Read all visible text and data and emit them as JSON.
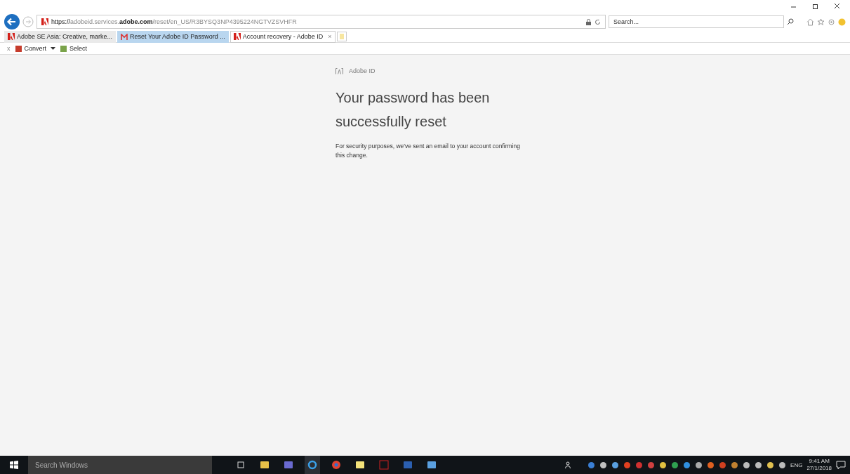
{
  "browser": {
    "address": {
      "scheme": "https://",
      "host_prefix": "adobeid.services.",
      "host_domain": "adobe.com",
      "path": "/reset/en_US/R3BYSQ3NP4395224NGTVZSVHFR"
    },
    "search": {
      "placeholder": "Search..."
    },
    "tabs": [
      {
        "label": "Adobe SE Asia: Creative, marke...",
        "selected": false,
        "hovered": false
      },
      {
        "label": "Reset Your Adobe ID Password ...",
        "selected": false,
        "hovered": true
      },
      {
        "label": "Account recovery - Adobe ID",
        "selected": true,
        "hovered": false
      }
    ],
    "close_tab": "×",
    "command_close": "x",
    "commands": [
      {
        "label": "Convert",
        "dropdown": true
      },
      {
        "label": "Select",
        "dropdown": false
      }
    ]
  },
  "page": {
    "brand": "Adobe ID",
    "heading_lines": [
      "Your password has been",
      "successfully reset"
    ],
    "message": "For security purposes, we've sent an email to your account confirming this change."
  },
  "taskbar": {
    "search_placeholder": "Search Windows",
    "language": "ENG",
    "time": "9:41 AM",
    "date": "27/1/2018"
  }
}
